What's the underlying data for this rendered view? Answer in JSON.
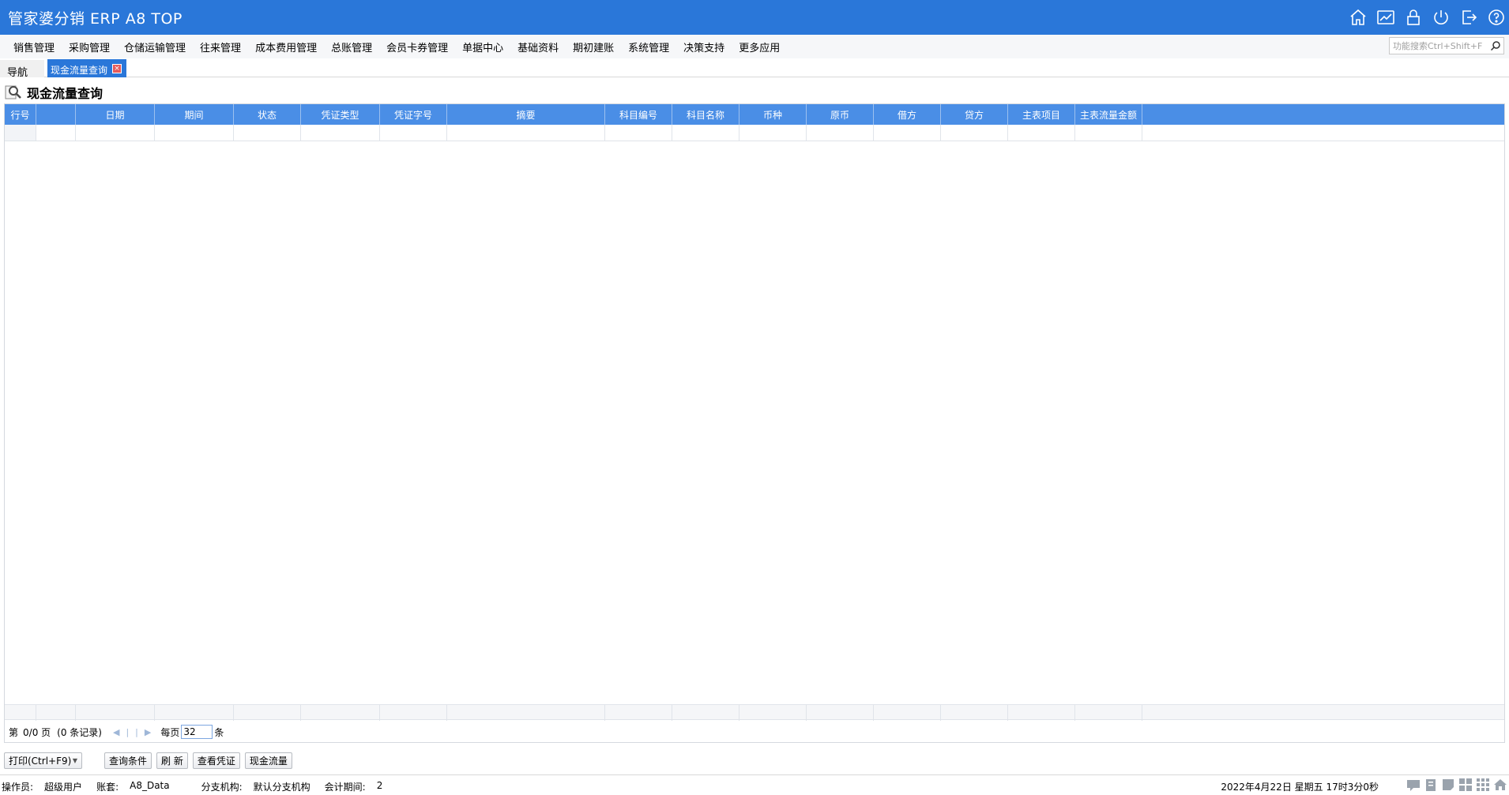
{
  "app": {
    "title": "管家婆分销 ERP A8 TOP"
  },
  "title_icons": [
    "home-icon",
    "chart-icon",
    "lock-icon",
    "power-icon",
    "logout-icon",
    "help-icon"
  ],
  "menu": {
    "items": [
      "销售管理",
      "采购管理",
      "仓储运输管理",
      "往来管理",
      "成本费用管理",
      "总账管理",
      "会员卡券管理",
      "单据中心",
      "基础资料",
      "期初建账",
      "系统管理",
      "决策支持",
      "更多应用"
    ],
    "search_placeholder": "功能搜索Ctrl+Shift+F"
  },
  "tabs": {
    "nav_label": "导航",
    "active_label": "现金流量查询",
    "close_symbol": "×"
  },
  "page": {
    "title": "现金流量查询"
  },
  "grid": {
    "columns": [
      "行号",
      "",
      "日期",
      "期间",
      "状态",
      "凭证类型",
      "凭证字号",
      "摘要",
      "科目编号",
      "科目名称",
      "币种",
      "原币",
      "借方",
      "贷方",
      "主表项目",
      "主表流量金额"
    ]
  },
  "pager": {
    "prefix": "第",
    "page_info": "0/0 页",
    "record_info": "(0 条记录)",
    "per_page_label": "每页",
    "per_page_value": "32",
    "suffix": "条",
    "nav_first": "◀",
    "nav_prev": "|",
    "nav_next": "|",
    "nav_last": "▶"
  },
  "buttons": {
    "print": "打印(Ctrl+F9)",
    "query": "查询条件",
    "refresh": "刷  新",
    "view_voucher": "查看凭证",
    "cash_flow": "现金流量"
  },
  "status": {
    "operator_label": "操作员:",
    "operator_value": "超级用户",
    "account_label": "账套:",
    "account_value": "A8_Data",
    "branch_label": "分支机构:",
    "branch_value": "默认分支机构",
    "period_label": "会计期间:",
    "period_value": "2",
    "datetime": "2022年4月22日  星期五  17时3分0秒"
  },
  "colors": {
    "brand_blue": "#2a77d9",
    "grid_header": "#4a8ee6"
  }
}
